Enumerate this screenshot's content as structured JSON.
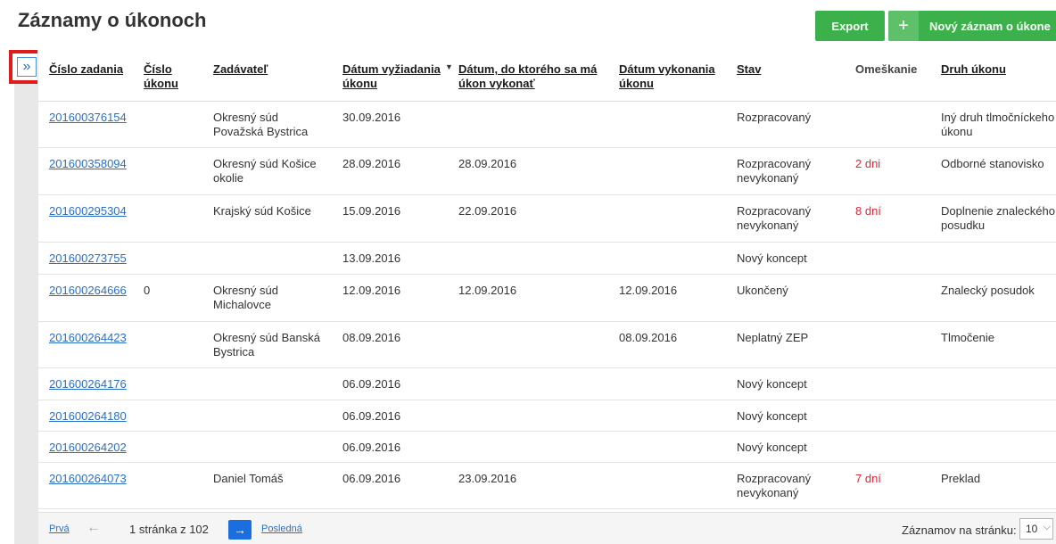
{
  "page": {
    "title": "Záznamy o úkonoch"
  },
  "toolbar": {
    "export_label": "Export",
    "new_plus": "+",
    "new_label": "Nový záznam o úkone"
  },
  "sidebar": {
    "expand_icon": "»"
  },
  "table": {
    "columns": [
      "Číslo zadania",
      "Číslo úkonu",
      "Zadávateľ",
      "Dátum vyžiadania úkonu",
      "Dátum, do ktorého sa má úkon vykonať",
      "Dátum vykonania úkonu",
      "Stav",
      "Omeškanie",
      "Druh úkonu"
    ],
    "sort_indicator": "▼",
    "rows": [
      {
        "cislo_zadania": "201600376154",
        "cislo_ukonu": "",
        "zadavatel": "Okresný súd Považská Bystrica",
        "datum_vyziadania": "30.09.2016",
        "datum_do": "",
        "datum_vykonania": "",
        "stav": "Rozpracovaný",
        "omeskanie": "",
        "druh": "Iný druh tlmočníckeho úkonu"
      },
      {
        "cislo_zadania": "201600358094",
        "cislo_ukonu": "",
        "zadavatel": "Okresný súd Košice okolie",
        "datum_vyziadania": "28.09.2016",
        "datum_do": "28.09.2016",
        "datum_vykonania": "",
        "stav": "Rozpracovaný nevykonaný",
        "omeskanie": "2 dni",
        "druh": "Odborné stanovisko"
      },
      {
        "cislo_zadania": "201600295304",
        "cislo_ukonu": "",
        "zadavatel": "Krajský súd Košice",
        "datum_vyziadania": "15.09.2016",
        "datum_do": "22.09.2016",
        "datum_vykonania": "",
        "stav": "Rozpracovaný nevykonaný",
        "omeskanie": "8 dní",
        "druh": "Doplnenie znaleckého posudku"
      },
      {
        "cislo_zadania": "201600273755",
        "cislo_ukonu": "",
        "zadavatel": "",
        "datum_vyziadania": "13.09.2016",
        "datum_do": "",
        "datum_vykonania": "",
        "stav": "Nový koncept",
        "omeskanie": "",
        "druh": ""
      },
      {
        "cislo_zadania": "201600264666",
        "cislo_ukonu": "0",
        "zadavatel": "Okresný súd Michalovce",
        "datum_vyziadania": "12.09.2016",
        "datum_do": "12.09.2016",
        "datum_vykonania": "12.09.2016",
        "stav": "Ukončený",
        "omeskanie": "",
        "druh": "Znalecký posudok"
      },
      {
        "cislo_zadania": "201600264423",
        "cislo_ukonu": "",
        "zadavatel": "Okresný súd Banská Bystrica",
        "datum_vyziadania": "08.09.2016",
        "datum_do": "",
        "datum_vykonania": "08.09.2016",
        "stav": "Neplatný ZEP",
        "omeskanie": "",
        "druh": "Tlmočenie"
      },
      {
        "cislo_zadania": "201600264176",
        "cislo_ukonu": "",
        "zadavatel": "",
        "datum_vyziadania": "06.09.2016",
        "datum_do": "",
        "datum_vykonania": "",
        "stav": "Nový koncept",
        "omeskanie": "",
        "druh": ""
      },
      {
        "cislo_zadania": "201600264180",
        "cislo_ukonu": "",
        "zadavatel": "",
        "datum_vyziadania": "06.09.2016",
        "datum_do": "",
        "datum_vykonania": "",
        "stav": "Nový koncept",
        "omeskanie": "",
        "druh": ""
      },
      {
        "cislo_zadania": "201600264202",
        "cislo_ukonu": "",
        "zadavatel": "",
        "datum_vyziadania": "06.09.2016",
        "datum_do": "",
        "datum_vykonania": "",
        "stav": "Nový koncept",
        "omeskanie": "",
        "druh": ""
      },
      {
        "cislo_zadania": "201600264073",
        "cislo_ukonu": "",
        "zadavatel": "Daniel Tomáš",
        "datum_vyziadania": "06.09.2016",
        "datum_do": "23.09.2016",
        "datum_vykonania": "",
        "stav": "Rozpracovaný nevykonaný",
        "omeskanie": "7 dní",
        "druh": "Preklad"
      }
    ]
  },
  "pagination": {
    "first": "Prvá",
    "prev_icon": "←",
    "info": "1 stránka z 102",
    "next_icon": "→",
    "last": "Posledná",
    "per_page_label": "Záznamov na stránku:",
    "per_page_value": "10",
    "per_page_chevron": "⌵"
  },
  "colors": {
    "accent_green": "#3cb04a",
    "link_blue": "#2a6fc4",
    "late_red": "#d9293a",
    "highlight_red": "#e01b1b"
  }
}
